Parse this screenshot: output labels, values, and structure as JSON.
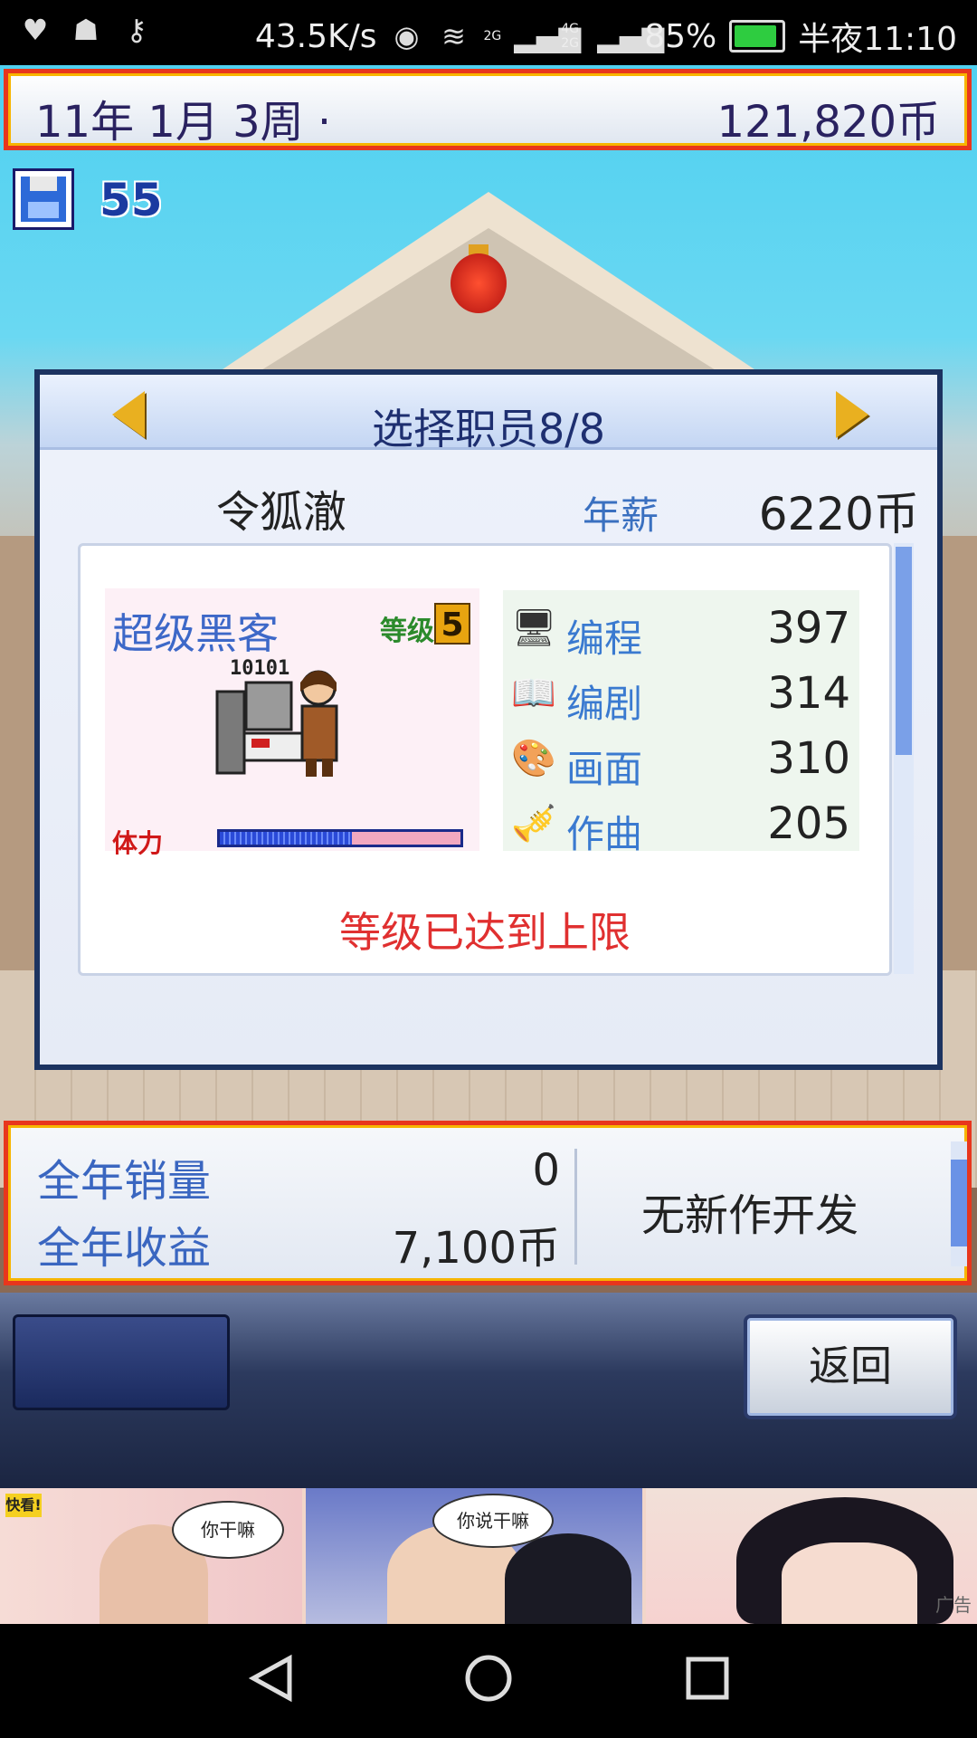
{
  "status_bar": {
    "network_speed": "43.5K/s",
    "signal_2g": "2G",
    "signal_4g": "4G 2G",
    "battery": "85%",
    "time": "半夜11:10"
  },
  "top_bar": {
    "date": "11年 1月 3周 ·",
    "money": "121,820币"
  },
  "save": {
    "count": "55"
  },
  "dialog": {
    "title": "选择职员8/8",
    "employee_name": "令狐澈",
    "salary_label": "年薪",
    "salary_value": "6220币",
    "job_title": "超级黑客",
    "level_label": "等级",
    "level_value": "5",
    "avatar_code": "10101",
    "hp_label": "体力",
    "hp_fraction": 0.55,
    "stats": [
      {
        "icon": "computer-icon",
        "label": "编程",
        "value": "397"
      },
      {
        "icon": "book-icon",
        "label": "编剧",
        "value": "314"
      },
      {
        "icon": "palette-icon",
        "label": "画面",
        "value": "310"
      },
      {
        "icon": "trumpet-icon",
        "label": "作曲",
        "value": "205"
      }
    ],
    "max_level_message": "等级已达到上限"
  },
  "info_bar": {
    "annual_sales_label": "全年销量",
    "annual_sales_value": "0",
    "annual_revenue_label": "全年收益",
    "annual_revenue_value": "7,100币",
    "dev_status": "无新作开发"
  },
  "menu": {
    "back_label": "返回"
  },
  "ad": {
    "tag": "快看!",
    "bubble1": "你干嘛",
    "bubble2": "你说干嘛",
    "label": "广告"
  },
  "colors": {
    "frame_red": "#e8361d",
    "frame_gold": "#f7b500",
    "title_navy": "#1e2f70",
    "label_blue": "#3a66c0",
    "warning_red": "#e03030"
  }
}
